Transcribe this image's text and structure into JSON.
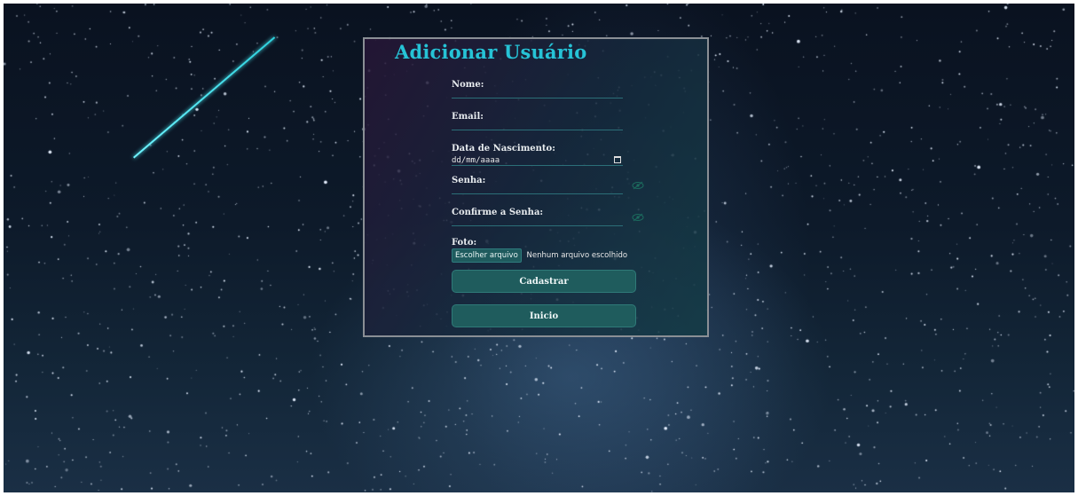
{
  "form": {
    "title": "Adicionar Usuário",
    "fields": {
      "nome_label": "Nome:",
      "email_label": "Email:",
      "data_label": "Data de Nascimento:",
      "data_placeholder": "dd/mm/aaaa",
      "senha_label": "Senha:",
      "confirma_label": "Confirme a Senha:",
      "foto_label": "Foto:"
    },
    "file": {
      "button_label": "Escolher arquivo",
      "status": "Nenhum arquivo escolhido"
    },
    "buttons": {
      "cadastrar": "Cadastrar",
      "inicio": "Inicio"
    }
  },
  "icons": {
    "calendar": "calendar-icon",
    "eye_senha": "eye-slash-icon",
    "eye_confirma": "eye-slash-icon"
  },
  "colors": {
    "title": "#26c3d6",
    "button_bg": "#1f5c5d",
    "field_line": "#2b6f78",
    "accent": "#2dd1dd"
  }
}
